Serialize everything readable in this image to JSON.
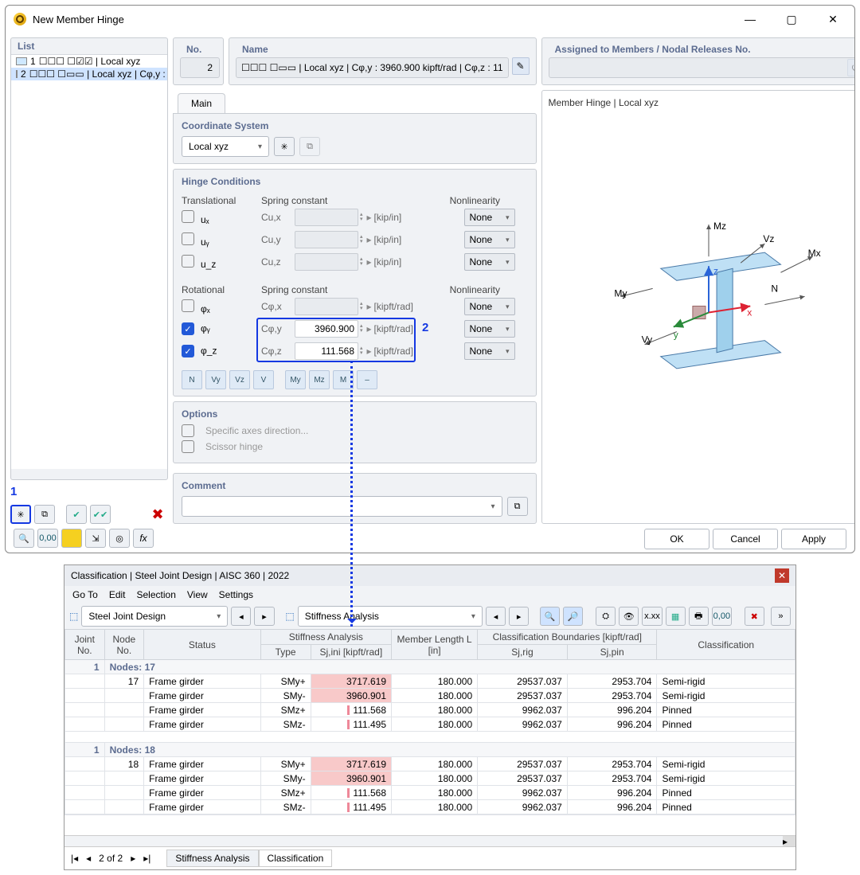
{
  "window": {
    "title": "New Member Hinge"
  },
  "list": {
    "header": "List",
    "items": [
      {
        "id": "1",
        "desc": "☐☐☐ ☐☑☑ | Local xyz"
      },
      {
        "id": "2",
        "desc": "☐☐☐ ☐▭▭ | Local xyz | Cφ,y : 3…"
      }
    ]
  },
  "callout1": "1",
  "callout2": "2",
  "no": {
    "label": "No.",
    "value": "2"
  },
  "name": {
    "label": "Name",
    "value": "☐☐☐ ☐▭▭ | Local xyz | Cφ,y : 3960.900 kipft/rad | Cφ,z : 11"
  },
  "assigned": {
    "label": "Assigned to Members / Nodal Releases No."
  },
  "tab_main": "Main",
  "coord": {
    "label": "Coordinate System",
    "value": "Local xyz"
  },
  "hinge_label": "Hinge Conditions",
  "trans_label": "Translational",
  "rot_label": "Rotational",
  "spring_label": "Spring constant",
  "nonlin_label": "Nonlinearity",
  "none": "None",
  "trans": [
    {
      "sym": "uₓ",
      "c": "Cu,x",
      "unit": "[kip/in]"
    },
    {
      "sym": "uᵧ",
      "c": "Cu,y",
      "unit": "[kip/in]"
    },
    {
      "sym": "u_z",
      "c": "Cu,z",
      "unit": "[kip/in]"
    }
  ],
  "rot": [
    {
      "sym": "φₓ",
      "c": "Cφ,x",
      "val": "",
      "unit": "[kipft/rad]",
      "on": false
    },
    {
      "sym": "φᵧ",
      "c": "Cφ,y",
      "val": "3960.900",
      "unit": "[kipft/rad]",
      "on": true
    },
    {
      "sym": "φ_z",
      "c": "Cφ,z",
      "val": "111.568",
      "unit": "[kipft/rad]",
      "on": true
    }
  ],
  "options": {
    "label": "Options",
    "o1": "Specific axes direction...",
    "o2": "Scissor hinge"
  },
  "comment": {
    "label": "Comment"
  },
  "diagram_title": "Member Hinge | Local xyz",
  "buttons": {
    "ok": "OK",
    "cancel": "Cancel",
    "apply": "Apply"
  },
  "lower": {
    "title": "Classification | Steel Joint Design | AISC 360 | 2022",
    "menu": [
      "Go To",
      "Edit",
      "Selection",
      "View",
      "Settings"
    ],
    "combo1": "Steel Joint Design",
    "combo2": "Stiffness Analysis",
    "cols": {
      "joint": "Joint No.",
      "node": "Node No.",
      "status": "Status",
      "stiff": "Stiffness Analysis",
      "type": "Type",
      "sjini": "Sj,ini [kipft/rad]",
      "mlen": "Member Length L [in]",
      "cb": "Classification Boundaries [kipft/rad]",
      "sjrig": "Sj,rig",
      "sjpin": "Sj,pin",
      "class": "Classification"
    },
    "groups": [
      {
        "joint": "1",
        "nodes_label": "Nodes: 17",
        "node": "17",
        "rows": [
          {
            "status": "Frame girder",
            "type": "SMy+",
            "sj": "3717.619",
            "len": "180.000",
            "rig": "29537.037",
            "pin": "2953.704",
            "cls": "Semi-rigid",
            "pink": true
          },
          {
            "status": "Frame girder",
            "type": "SMy-",
            "sj": "3960.901",
            "len": "180.000",
            "rig": "29537.037",
            "pin": "2953.704",
            "cls": "Semi-rigid",
            "pink": true
          },
          {
            "status": "Frame girder",
            "type": "SMz+",
            "sj": "111.568",
            "len": "180.000",
            "rig": "9962.037",
            "pin": "996.204",
            "cls": "Pinned",
            "pink": false
          },
          {
            "status": "Frame girder",
            "type": "SMz-",
            "sj": "111.495",
            "len": "180.000",
            "rig": "9962.037",
            "pin": "996.204",
            "cls": "Pinned",
            "pink": false
          }
        ]
      },
      {
        "joint": "1",
        "nodes_label": "Nodes: 18",
        "node": "18",
        "rows": [
          {
            "status": "Frame girder",
            "type": "SMy+",
            "sj": "3717.619",
            "len": "180.000",
            "rig": "29537.037",
            "pin": "2953.704",
            "cls": "Semi-rigid",
            "pink": true
          },
          {
            "status": "Frame girder",
            "type": "SMy-",
            "sj": "3960.901",
            "len": "180.000",
            "rig": "29537.037",
            "pin": "2953.704",
            "cls": "Semi-rigid",
            "pink": true
          },
          {
            "status": "Frame girder",
            "type": "SMz+",
            "sj": "111.568",
            "len": "180.000",
            "rig": "9962.037",
            "pin": "996.204",
            "cls": "Pinned",
            "pink": false
          },
          {
            "status": "Frame girder",
            "type": "SMz-",
            "sj": "111.495",
            "len": "180.000",
            "rig": "9962.037",
            "pin": "996.204",
            "cls": "Pinned",
            "pink": false
          }
        ]
      }
    ],
    "pager": "2 of 2",
    "tabs": [
      "Stiffness Analysis",
      "Classification"
    ]
  }
}
